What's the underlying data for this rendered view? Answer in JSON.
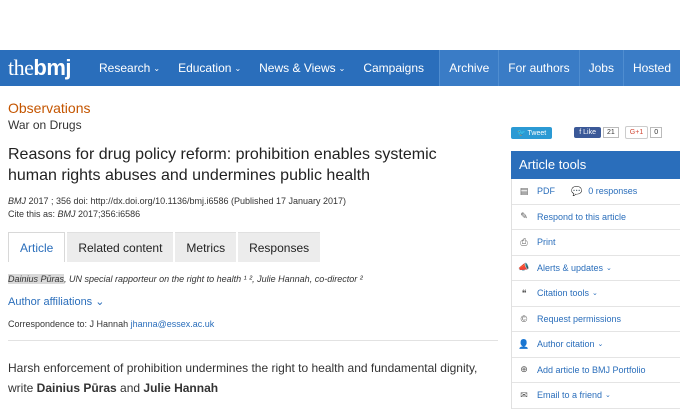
{
  "nav": {
    "logo_the": "the",
    "logo_bmj": "bmj",
    "left_items": [
      {
        "label": "Research",
        "caret": "⌄"
      },
      {
        "label": "Education",
        "caret": "⌄"
      },
      {
        "label": "News & Views",
        "caret": "⌄"
      },
      {
        "label": "Campaigns",
        "caret": ""
      }
    ],
    "right_items": [
      "Archive",
      "For authors",
      "Jobs",
      "Hosted"
    ]
  },
  "article": {
    "section": "Observations",
    "subsection": "War on Drugs",
    "title": "Reasons for drug policy reform: prohibition enables systemic human rights abuses and undermines public health",
    "journal": "BMJ",
    "cite_line1_rest": " 2017 ; 356  doi: http://dx.doi.org/10.1136/bmj.i6586 (Published 17 January 2017)",
    "cite_line2_prefix": "Cite this as: ",
    "cite_line2_rest": " 2017;356:i6586",
    "tabs": [
      "Article",
      "Related content",
      "Metrics",
      "Responses"
    ],
    "author1": "Dainius Pūras",
    "author1_role": ", UN special rapporteur on the right to health ¹ ², ",
    "author2": "Julie Hannah",
    "author2_role": ", co-director ²",
    "affiliations": "Author affiliations ⌄",
    "correspondence_label": "Correspondence to: J Hannah ",
    "correspondence_email": "jhanna@essex.ac.uk",
    "standfirst_text": "Harsh enforcement of prohibition undermines the right to health and fundamental dignity, write ",
    "standfirst_author1": "Dainius Pūras",
    "standfirst_and": " and ",
    "standfirst_author2": "Julie Hannah"
  },
  "social": {
    "tweet": "Tweet",
    "like": "Like",
    "like_count": "21",
    "gplus": "G+1",
    "gplus_count": "0"
  },
  "tools": {
    "heading": "Article tools",
    "pdf": "PDF",
    "responses": "0 responses",
    "items": [
      {
        "icon": "pencil-icon",
        "glyph": "✎",
        "label": "Respond to this article",
        "caret": ""
      },
      {
        "icon": "print-icon",
        "glyph": "⎙",
        "label": "Print",
        "caret": ""
      },
      {
        "icon": "megaphone-icon",
        "glyph": "📣",
        "label": "Alerts & updates",
        "caret": "⌄"
      },
      {
        "icon": "quote-icon",
        "glyph": "❝",
        "label": "Citation tools",
        "caret": "⌄"
      },
      {
        "icon": "copyright-icon",
        "glyph": "©",
        "label": "Request permissions",
        "caret": ""
      },
      {
        "icon": "user-icon",
        "glyph": "👤",
        "label": "Author citation",
        "caret": "⌄"
      },
      {
        "icon": "plus-circle-icon",
        "glyph": "⊕",
        "label": "Add article to BMJ Portfolio",
        "caret": ""
      },
      {
        "icon": "envelope-icon",
        "glyph": "✉",
        "label": "Email to a friend",
        "caret": "⌄"
      }
    ]
  }
}
